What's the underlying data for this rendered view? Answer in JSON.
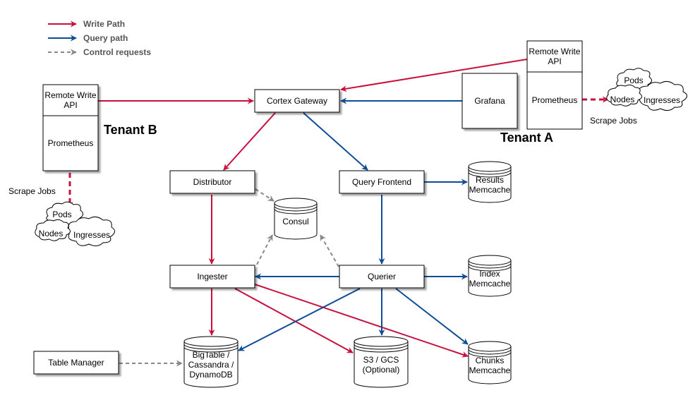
{
  "colors": {
    "write": "#c8103e",
    "query": "#0f4c96",
    "control": "#888888"
  },
  "legend": [
    {
      "label": "Write Path",
      "kind": "write"
    },
    {
      "label": "Query path",
      "kind": "query"
    },
    {
      "label": "Control requests",
      "kind": "control"
    }
  ],
  "tenants": {
    "b": {
      "label": "Tenant B",
      "api": [
        "Remote Write",
        "API"
      ],
      "prometheus": "Prometheus",
      "scrape_label": "Scrape Jobs",
      "clouds": [
        "Pods",
        "Nodes",
        "Ingresses"
      ]
    },
    "a": {
      "label": "Tenant A",
      "api": [
        "Remote Write",
        "API"
      ],
      "prometheus": "Prometheus",
      "scrape_label": "Scrape Jobs",
      "clouds": [
        "Pods",
        "Nodes",
        "Ingresses"
      ]
    }
  },
  "components": {
    "gateway": "Cortex Gateway",
    "grafana": "Grafana",
    "distributor": "Distributor",
    "query_frontend": "Query Frontend",
    "ingester": "Ingester",
    "querier": "Querier",
    "table_manager": "Table Manager"
  },
  "stores": {
    "consul": [
      "Consul"
    ],
    "results_memcache": [
      "Results",
      "Memcache"
    ],
    "index_memcache": [
      "Index",
      "Memcache"
    ],
    "bigtable": [
      "BigTable /",
      "Cassandra /",
      "DynamoDB"
    ],
    "s3": [
      "S3 / GCS",
      "(Optional)"
    ],
    "chunks_memcache": [
      "Chunks",
      "Memcache"
    ]
  }
}
